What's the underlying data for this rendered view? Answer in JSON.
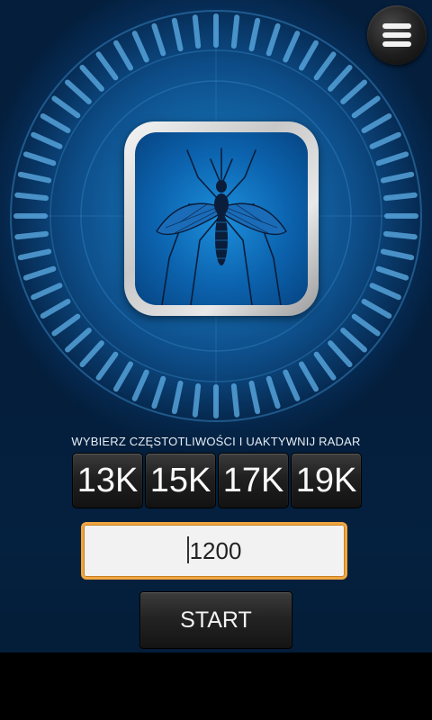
{
  "menu": {
    "icon": "hamburger-menu-icon"
  },
  "radar": {
    "icon": "radar-dial",
    "accent": "#5fb0e8"
  },
  "hero": {
    "icon": "mosquito-icon"
  },
  "instruction": "WYBIERZ CZĘSTOTLIWOŚCI I UAKTYWNIJ RADAR",
  "frequencies": [
    {
      "label": "13K"
    },
    {
      "label": "15K"
    },
    {
      "label": "17K"
    },
    {
      "label": "19K"
    }
  ],
  "frequency_input": {
    "value": "1200"
  },
  "start_button": {
    "label": "START"
  },
  "colors": {
    "background": "#0a4680",
    "input_border": "#f0a640",
    "button": "#202020",
    "button_text": "#fafafa"
  }
}
